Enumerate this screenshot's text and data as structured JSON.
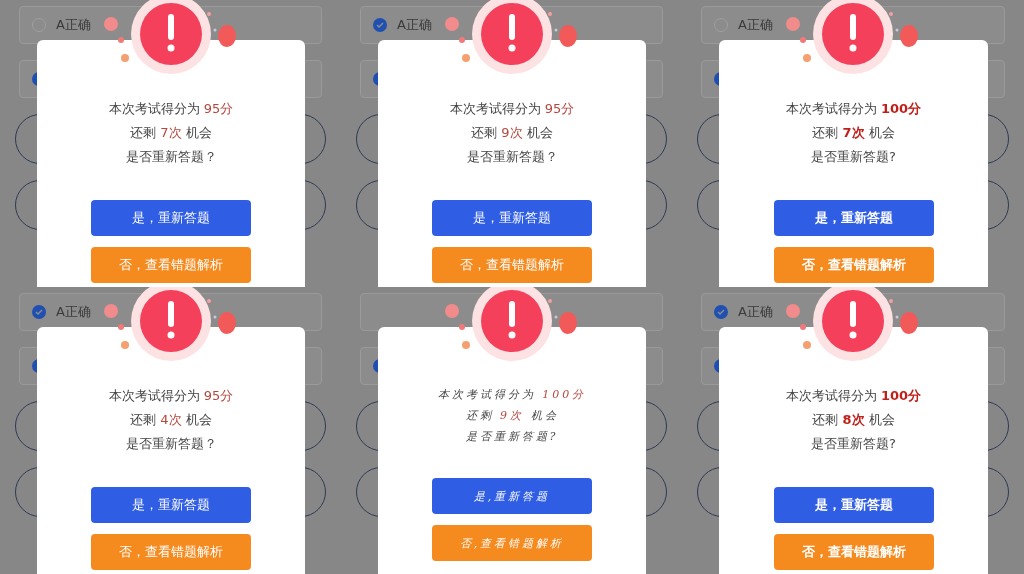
{
  "panels": [
    {
      "option": {
        "label": "A正确",
        "checked": false
      },
      "second_option": {
        "checked": true
      },
      "kind": "standard",
      "bold_highlight": false,
      "score_prefix": "本次考试得分为",
      "score": "95分",
      "remain_prefix": "还剩",
      "remain": "7次",
      "remain_suffix": "机会",
      "question": "是否重新答题？",
      "retry_button": "是，重新答题",
      "review_button": "否，查看错题解析"
    },
    {
      "option": {
        "label": "A正确",
        "checked": true
      },
      "second_option": {
        "checked": true
      },
      "kind": "standard",
      "bold_highlight": false,
      "score_prefix": "本次考试得分为",
      "score": "95分",
      "remain_prefix": "还剩",
      "remain": "9次",
      "remain_suffix": "机会",
      "question": "是否重新答题？",
      "retry_button": "是，重新答题",
      "review_button": "否，查看错题解析"
    },
    {
      "option": {
        "label": "A正确",
        "checked": false
      },
      "second_option": {
        "checked": true
      },
      "kind": "standard",
      "bold_highlight": true,
      "score_prefix": "本次考试得分为",
      "score": "100分",
      "remain_prefix": "还剩",
      "remain": "7次",
      "remain_suffix": "机会",
      "question": "是否重新答题?",
      "retry_button": "是，重新答题",
      "review_button": "否，查看错题解析"
    },
    {
      "option": {
        "label": "A正确",
        "checked": true
      },
      "second_option": {
        "checked": true
      },
      "kind": "standard",
      "bold_highlight": false,
      "score_prefix": "本次考试得分为",
      "score": "95分",
      "remain_prefix": "还剩",
      "remain": "4次",
      "remain_suffix": "机会",
      "question": "是否重新答题？",
      "retry_button": "是，重新答题",
      "review_button": "否，查看错题解析"
    },
    {
      "second_option": {
        "checked": true
      },
      "kind": "handwritten",
      "bold_highlight": false,
      "score_prefix": "本次考试得分为",
      "score": "100分",
      "remain_prefix": "还剩",
      "remain": "9次",
      "remain_suffix": "机会",
      "question": "是否重新答题?",
      "retry_button": "是,重新答题",
      "review_button": "否,查看错题解析"
    },
    {
      "option": {
        "label": "A正确",
        "checked": true
      },
      "second_option": {
        "checked": true
      },
      "kind": "standard",
      "bold_highlight": true,
      "score_prefix": "本次考试得分为",
      "score": "100分",
      "remain_prefix": "还剩",
      "remain": "8次",
      "remain_suffix": "机会",
      "question": "是否重新答题?",
      "retry_button": "是，重新答题",
      "review_button": "否，查看错题解析"
    }
  ]
}
